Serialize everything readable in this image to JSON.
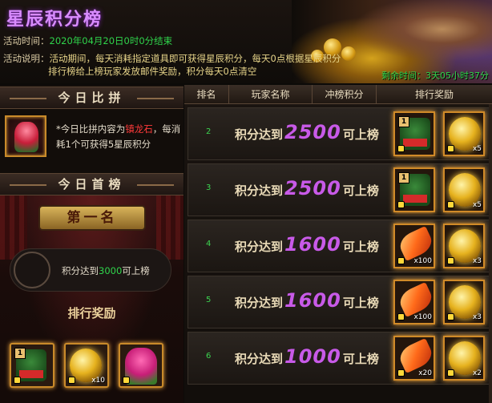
{
  "header": {
    "title": "星辰积分榜",
    "time_label": "活动时间：",
    "time_value": "2020年04月20日0时0分结束",
    "desc_label": "活动说明：",
    "desc_line1": "活动期间，每天消耗指定道具即可获得星辰积分，每天0点根据星辰积分",
    "desc_line2": "排行榜给上榜玩家发放邮件奖励，积分每天0点清空",
    "remaining": "剩余时间：3天05小时37分"
  },
  "left": {
    "today_compare_title": "今日比拼",
    "compare_text_1": "*今日比拼内容为",
    "compare_highlight": "镇龙石",
    "compare_text_2": "，每消耗1个可获得5星辰积分",
    "today_top_title": "今日首榜",
    "first_place_label": "第一名",
    "rank_text_prefix": "积分达到",
    "rank_score": "3000",
    "rank_text_suffix": "可上榜",
    "reward_title": "排行奖励",
    "rewards": [
      {
        "icon": "chest-icon",
        "count": ""
      },
      {
        "icon": "gold-icon",
        "count": "x10"
      },
      {
        "icon": "flower-icon",
        "count": ""
      }
    ]
  },
  "table": {
    "headers": [
      "排名",
      "玩家名称",
      "冲榜积分",
      "排行奖励"
    ],
    "score_prefix": "积分达到",
    "score_suffix": "可上榜",
    "rows": [
      {
        "rank": "2",
        "score": "2500",
        "reward1": {
          "icon": "chest-icon",
          "count": ""
        },
        "reward2": {
          "icon": "gold-icon",
          "count": "x5"
        }
      },
      {
        "rank": "3",
        "score": "2500",
        "reward1": {
          "icon": "chest-icon",
          "count": ""
        },
        "reward2": {
          "icon": "gold-icon",
          "count": "x5"
        }
      },
      {
        "rank": "4",
        "score": "1600",
        "reward1": {
          "icon": "feather-icon",
          "count": "x100"
        },
        "reward2": {
          "icon": "gold-icon",
          "count": "x3"
        }
      },
      {
        "rank": "5",
        "score": "1600",
        "reward1": {
          "icon": "feather-icon",
          "count": "x100"
        },
        "reward2": {
          "icon": "gold-icon",
          "count": "x3"
        }
      },
      {
        "rank": "6",
        "score": "1000",
        "reward1": {
          "icon": "feather-icon",
          "count": "x20"
        },
        "reward2": {
          "icon": "gold-icon",
          "count": "x2"
        }
      }
    ]
  },
  "colors": {
    "accent_purple": "#c85ae8",
    "green_text": "#2fd44b",
    "gold_border": "#d08a28"
  }
}
